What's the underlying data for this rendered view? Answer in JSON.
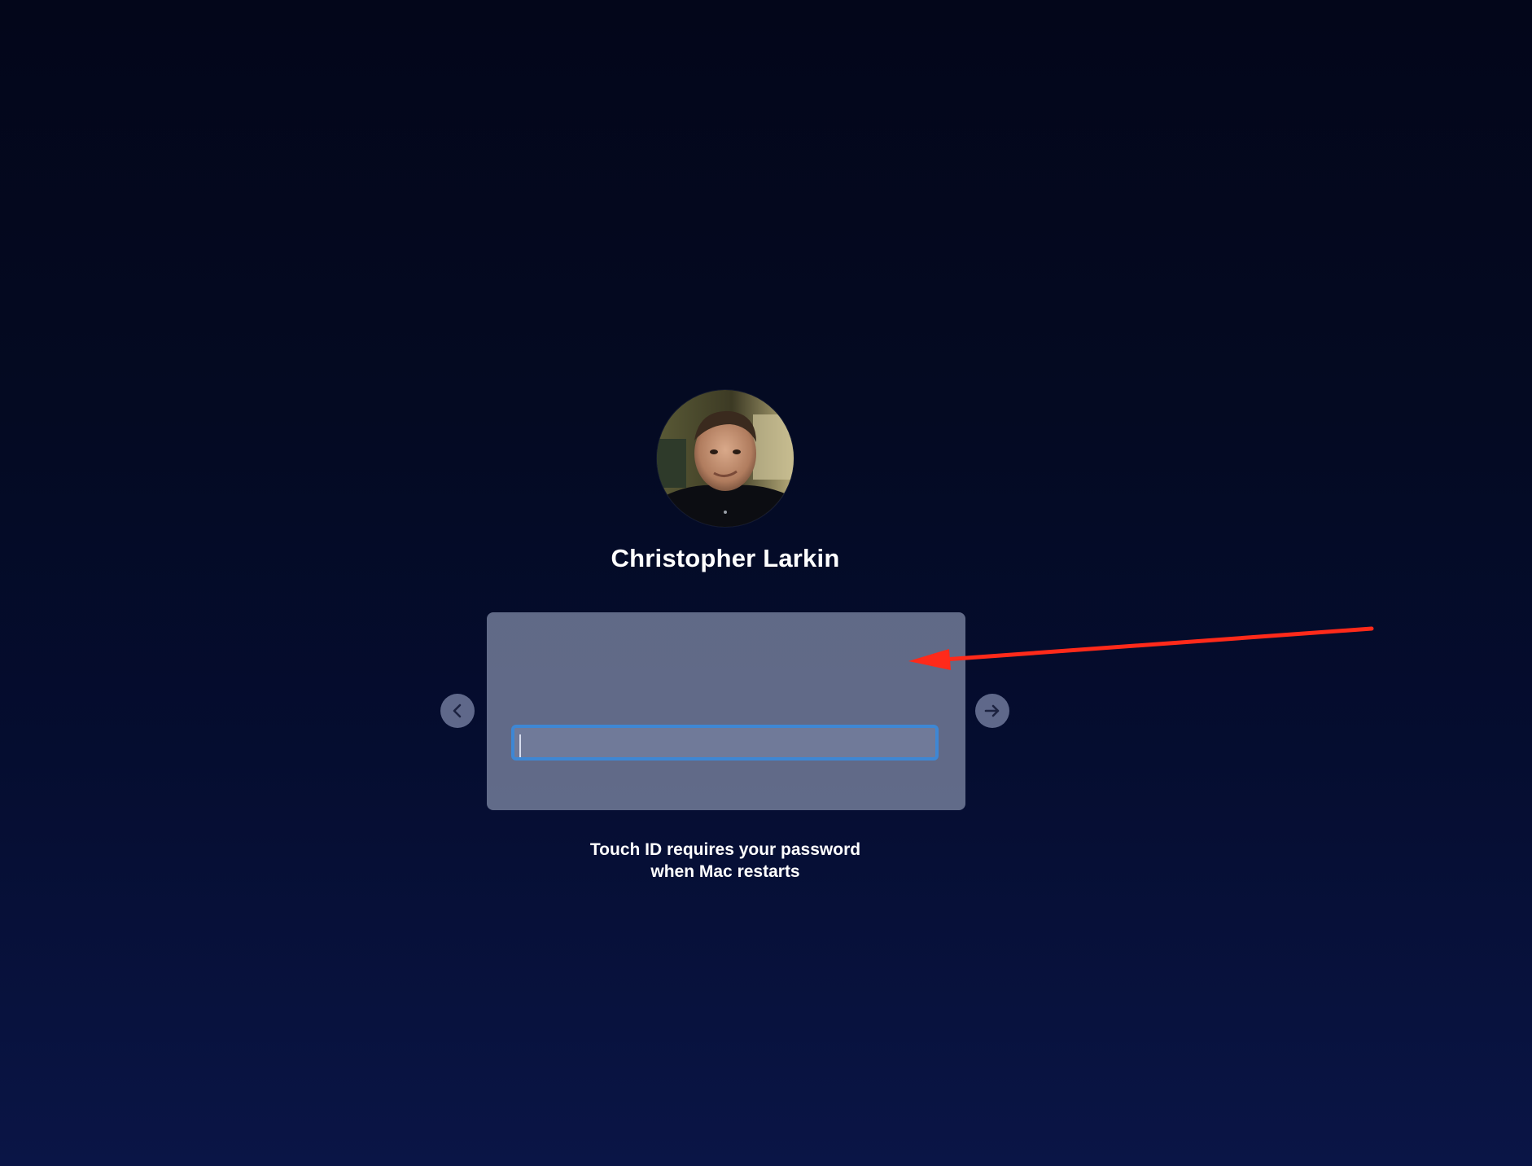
{
  "user": {
    "name": "Christopher Larkin"
  },
  "login": {
    "password_value": "",
    "password_placeholder": ""
  },
  "hint": {
    "line1": "Touch ID requires your password",
    "line2": "when Mac restarts"
  },
  "icons": {
    "back": "chevron-left-icon",
    "submit": "arrow-right-icon"
  },
  "colors": {
    "field_focus_ring": "#3e87d4",
    "annotation_arrow": "#ff2a1a"
  }
}
